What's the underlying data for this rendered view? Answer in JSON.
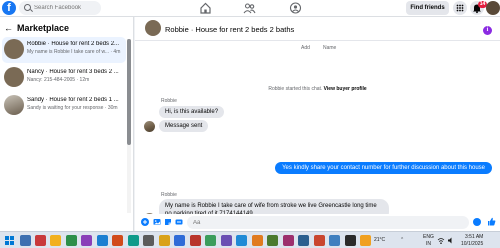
{
  "topbar": {
    "logo": "f",
    "search_placeholder": "Search Facebook",
    "find_friends": "Find friends",
    "notification_count": "14"
  },
  "sidebar": {
    "title": "Marketplace",
    "conversations": [
      {
        "title": "Robbie · House for rent 2 beds 2...",
        "preview": "My name is Robbie I take care of w... · 4m",
        "active": true
      },
      {
        "title": "Nancy · House for rent 3 beds 2 ...",
        "preview": "Nancy: 215-484-2005 · 12m",
        "active": false
      },
      {
        "title": "Sandy · House for rent 2 beds 1 ...",
        "preview": "Sandy is waiting for your response · 30m",
        "active": false
      }
    ]
  },
  "chat": {
    "header_title": "Robbie · House for rent 2 beds 2 baths",
    "button_labels": [
      "Add",
      "Name"
    ],
    "system_name": "Robbie",
    "system_text": "started this chat.",
    "system_link": "View buyer profile",
    "messages": [
      {
        "sender": "Robbie",
        "direction": "in",
        "text": "Hi, is this available?"
      },
      {
        "sender": "",
        "direction": "in",
        "text": "Message sent"
      },
      {
        "sender": "",
        "direction": "out",
        "text": "Yes kindly share your contact number for further discussion about this house"
      },
      {
        "sender": "Robbie",
        "direction": "in",
        "text": "My name is Robbie  I take  care of wife from stroke  we live Greencastle  long  time no parking tired of it  7174144149"
      }
    ],
    "composer_placeholder": "Aa"
  },
  "taskbar": {
    "temperature": "21°C",
    "language_top": "ENG",
    "language_bottom": "IN",
    "time": "3:51 AM",
    "date": "10/1/2025"
  },
  "colors": {
    "facebook_blue": "#1877f2",
    "outgoing_bubble": "#0a7cff",
    "incoming_bubble": "#e4e6eb",
    "badge_red": "#e41e3f",
    "info_purple": "#8b2be2"
  }
}
